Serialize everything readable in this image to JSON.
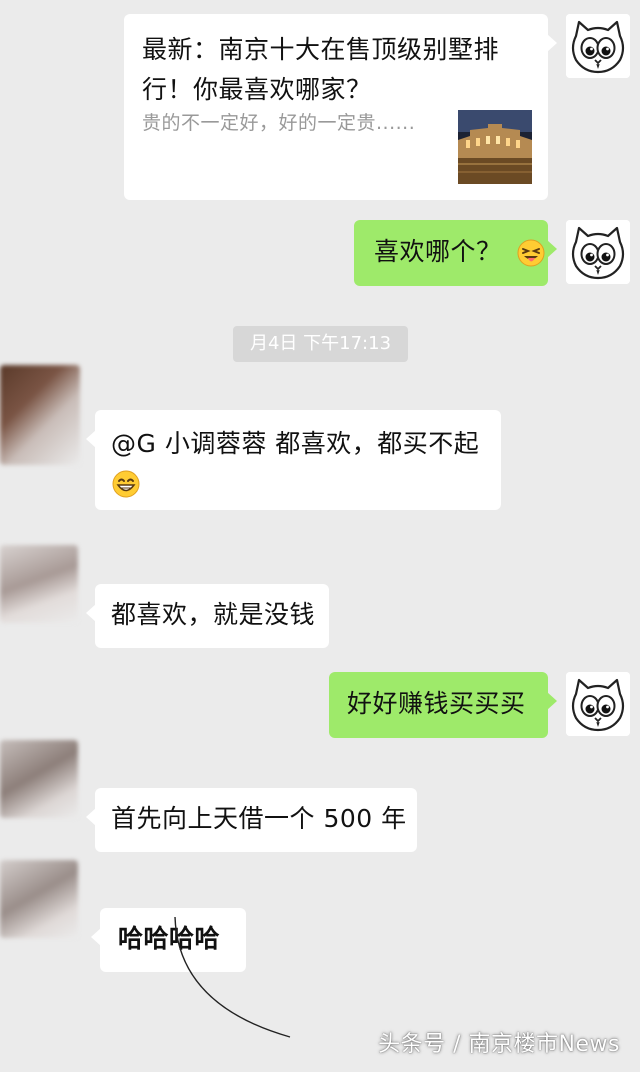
{
  "link_card": {
    "title": "最新：南京十大在售顶级别墅排行！你最喜欢哪家？",
    "description": "贵的不一定好，好的一定贵......"
  },
  "messages": {
    "m1": "喜欢哪个？",
    "timestamp": "月4日 下午17:13",
    "m2": "@G 小调蓉蓉  都喜欢，都买不起",
    "m3": "都喜欢，就是没钱",
    "m4": "好好赚钱买买买",
    "m5": "首先向上天借一个 500 年",
    "m6": "哈哈哈哈"
  },
  "watermark": "头条号 / 南京楼市News",
  "colors": {
    "background": "#ebebeb",
    "sent_bubble": "#9eea6a",
    "received_bubble": "#ffffff",
    "timestamp_bg": "#d7d7d7"
  },
  "icons": {
    "self_avatar": "cat-face-icon",
    "emoji_squint": "squinting-tongue-emoji-icon",
    "emoji_grin": "grinning-smile-emoji-icon"
  }
}
